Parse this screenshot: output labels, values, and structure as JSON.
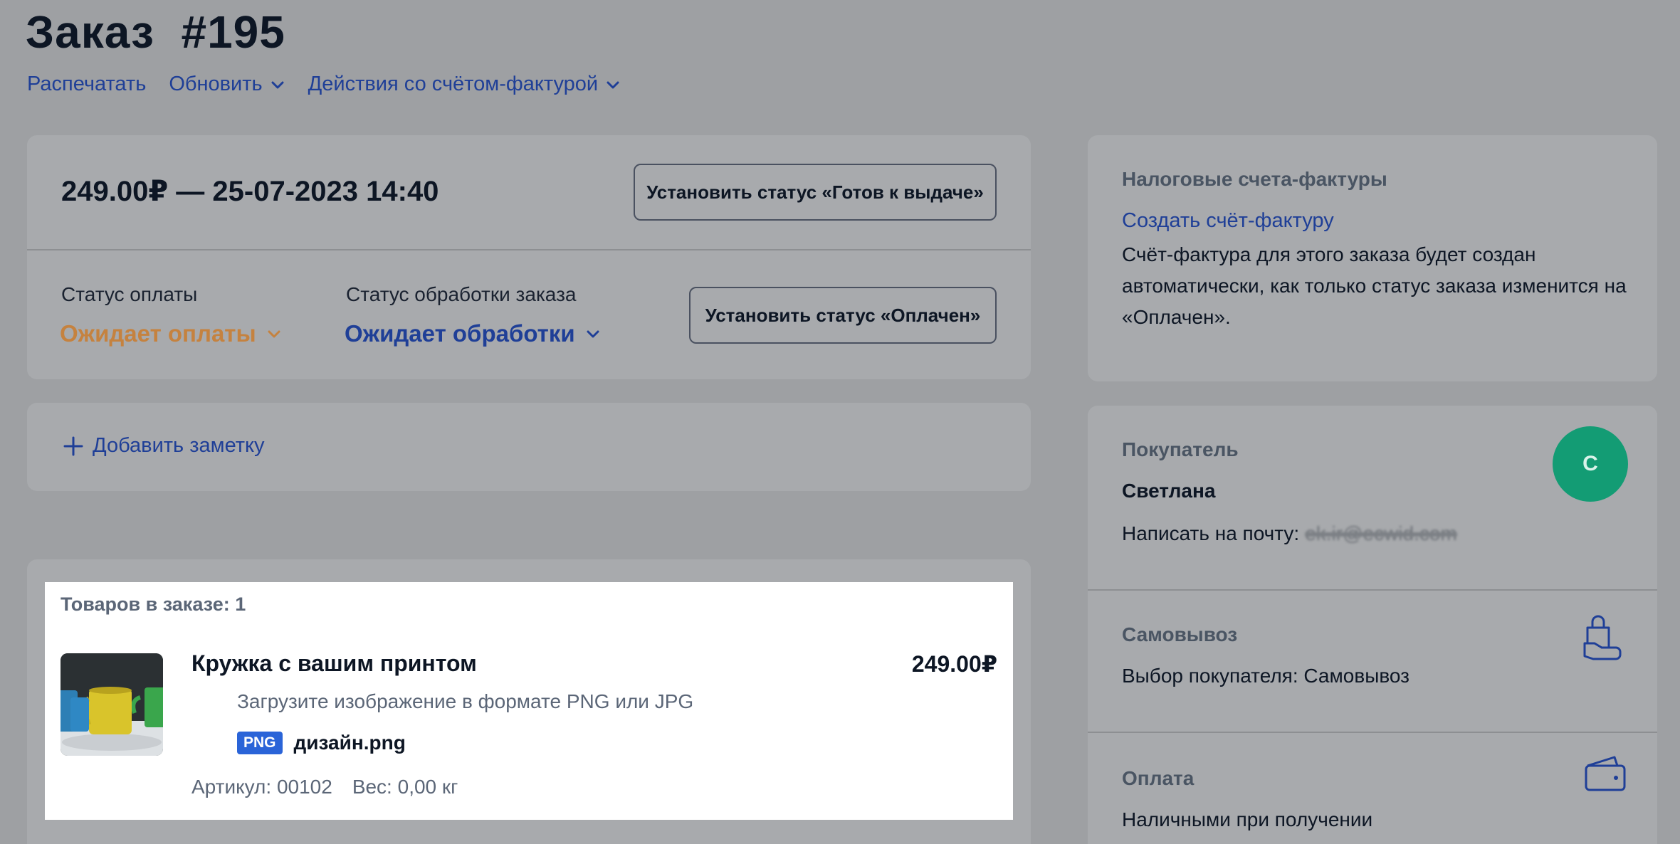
{
  "header": {
    "title": "Заказ  #195",
    "links": {
      "print": "Распечатать",
      "update": "Обновить",
      "invoice_actions": "Действия со счётом-фактурой"
    }
  },
  "order": {
    "total_line": "249.00₽ — 25-07-2023 14:40",
    "set_ready_button": "Установить статус «Готов к выдаче»",
    "payment_status_label": "Статус оплаты",
    "payment_status_value": "Ожидает оплаты",
    "processing_status_label": "Статус обработки заказа",
    "processing_status_value": "Ожидает обработки",
    "set_paid_button": "Установить статус «Оплачен»"
  },
  "note": {
    "add_label": "Добавить заметку"
  },
  "items": {
    "count_label": "Товаров в заказе: 1",
    "list": [
      {
        "name": "Кружка с вашим принтом",
        "price": "249.00₽",
        "upload_hint": "Загрузите изображение в формате PNG или JPG",
        "file_badge": "PNG",
        "file_name": "дизайн.png",
        "sku": "Артикул: 00102",
        "weight": "Вес: 0,00 кг"
      }
    ]
  },
  "invoice": {
    "title": "Налоговые счета-фактуры",
    "create_link": "Создать счёт-фактуру",
    "description": "Счёт-фактура для этого заказа будет создан автоматически, как только статус заказа изменится на «Оплачен»."
  },
  "customer": {
    "title": "Покупатель",
    "name": "Светлана",
    "email_label": "Написать на почту:",
    "email_value": "ek.ir@ecwid.com",
    "avatar_letter": "C",
    "avatar_color": "#139c74"
  },
  "pickup": {
    "title": "Самовывоз",
    "text": "Выбор покупателя: Самовывоз"
  },
  "payment": {
    "title": "Оплата",
    "text": "Наличными при получении"
  },
  "colors": {
    "background": "#9ea0a3",
    "card": "#a8aaad",
    "link": "#1f3f97",
    "pending_payment": "#c5823f",
    "badge": "#2a64d8"
  },
  "icons": {
    "dropdown": "chevron-down-icon",
    "add": "plus-icon",
    "pickup": "shopping-bag-hand-icon",
    "payment": "wallet-icon"
  }
}
